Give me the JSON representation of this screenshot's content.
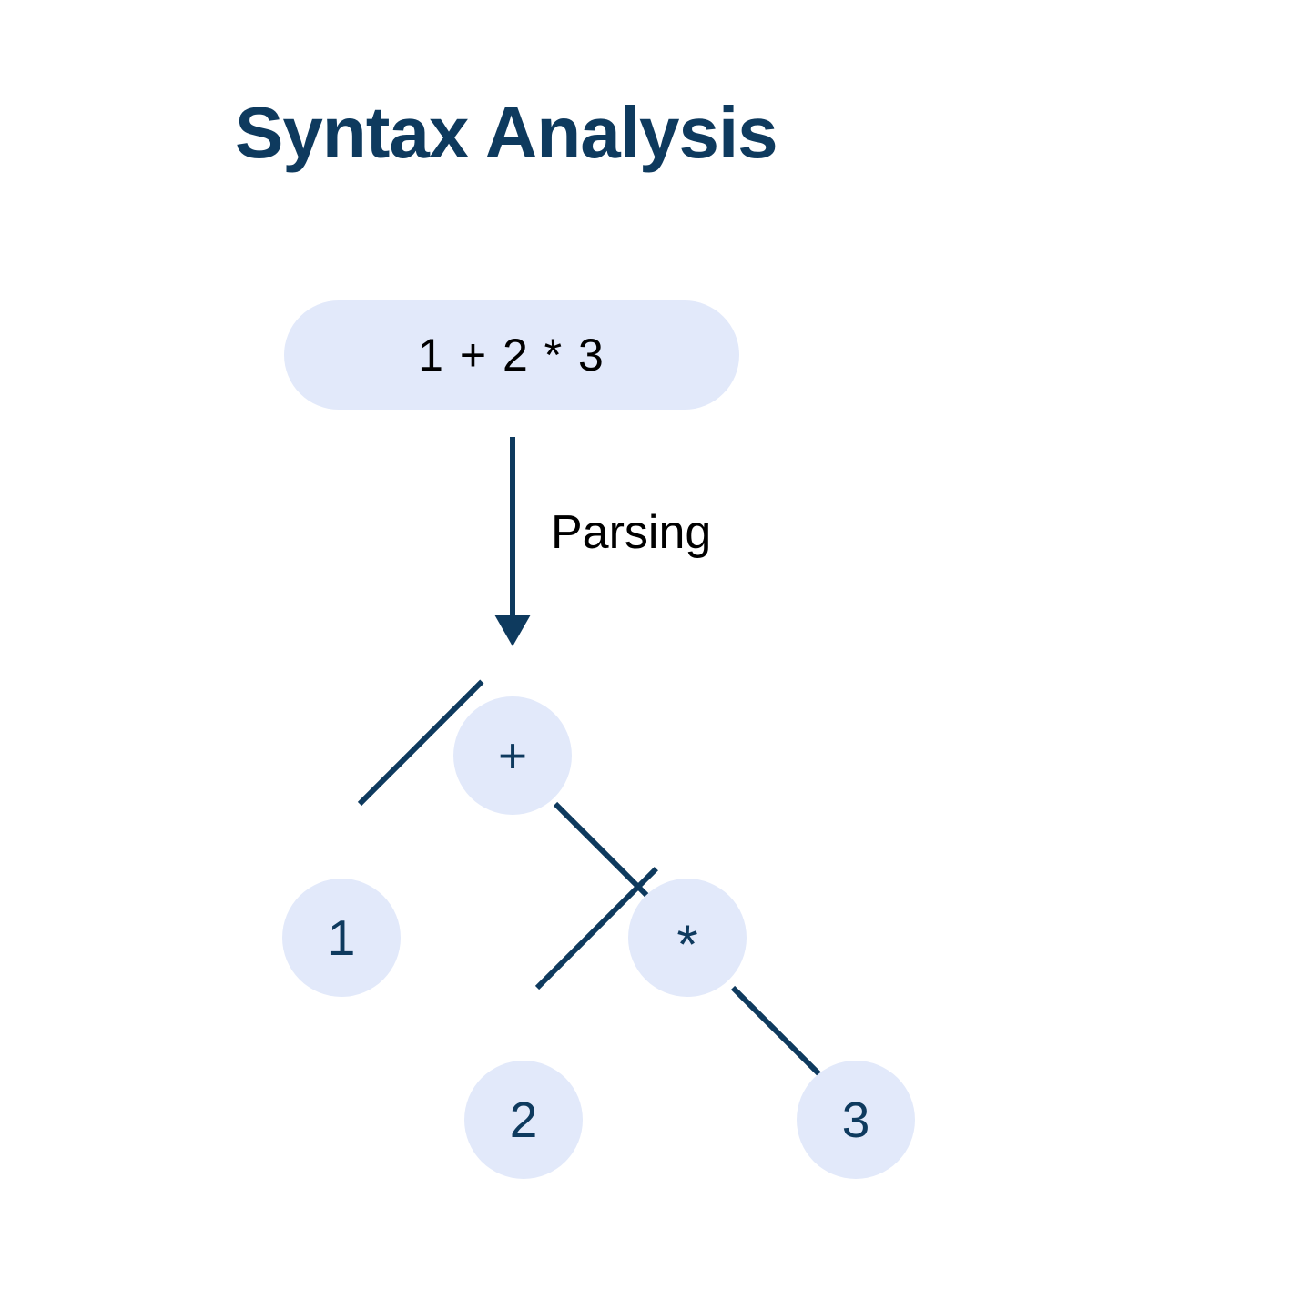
{
  "title": "Syntax Analysis",
  "expression": "1 + 2 * 3",
  "arrow_label": "Parsing",
  "tree": {
    "root": "+",
    "left1": "1",
    "right1": "*",
    "left2": "2",
    "right2": "3"
  },
  "colors": {
    "primary": "#0e3a5e",
    "node_bg": "#e2e9fa",
    "text": "#000000"
  }
}
